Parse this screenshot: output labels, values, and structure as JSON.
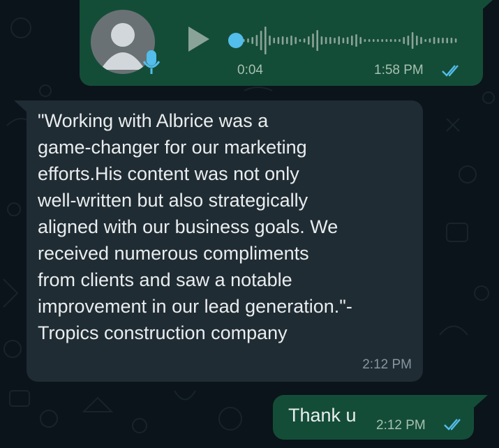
{
  "voice_message": {
    "duration": "0:04",
    "time": "1:58 PM",
    "status": "read",
    "progress": 0.0
  },
  "incoming_message": {
    "text": "\"Working with Albrice was a\ngame-changer for our marketing\nefforts.His content was not only\nwell-written but also strategically\naligned with our business goals. We\nreceived numerous compliments\nfrom clients and saw a notable\nimprovement in our lead generation.\"-\nTropics construction company",
    "time": "2:12 PM"
  },
  "outgoing_message": {
    "text": "Thank u",
    "time": "2:12 PM",
    "status": "read"
  },
  "colors": {
    "background": "#0b141a",
    "outgoing_bubble": "#144d37",
    "incoming_bubble": "#202c33",
    "read_ticks": "#53bdeb",
    "avatar": "#6a7175"
  },
  "icons": {
    "avatar": "default-contact-avatar-icon",
    "mic": "microphone-icon",
    "play": "play-icon",
    "read_receipt": "double-check-icon"
  }
}
